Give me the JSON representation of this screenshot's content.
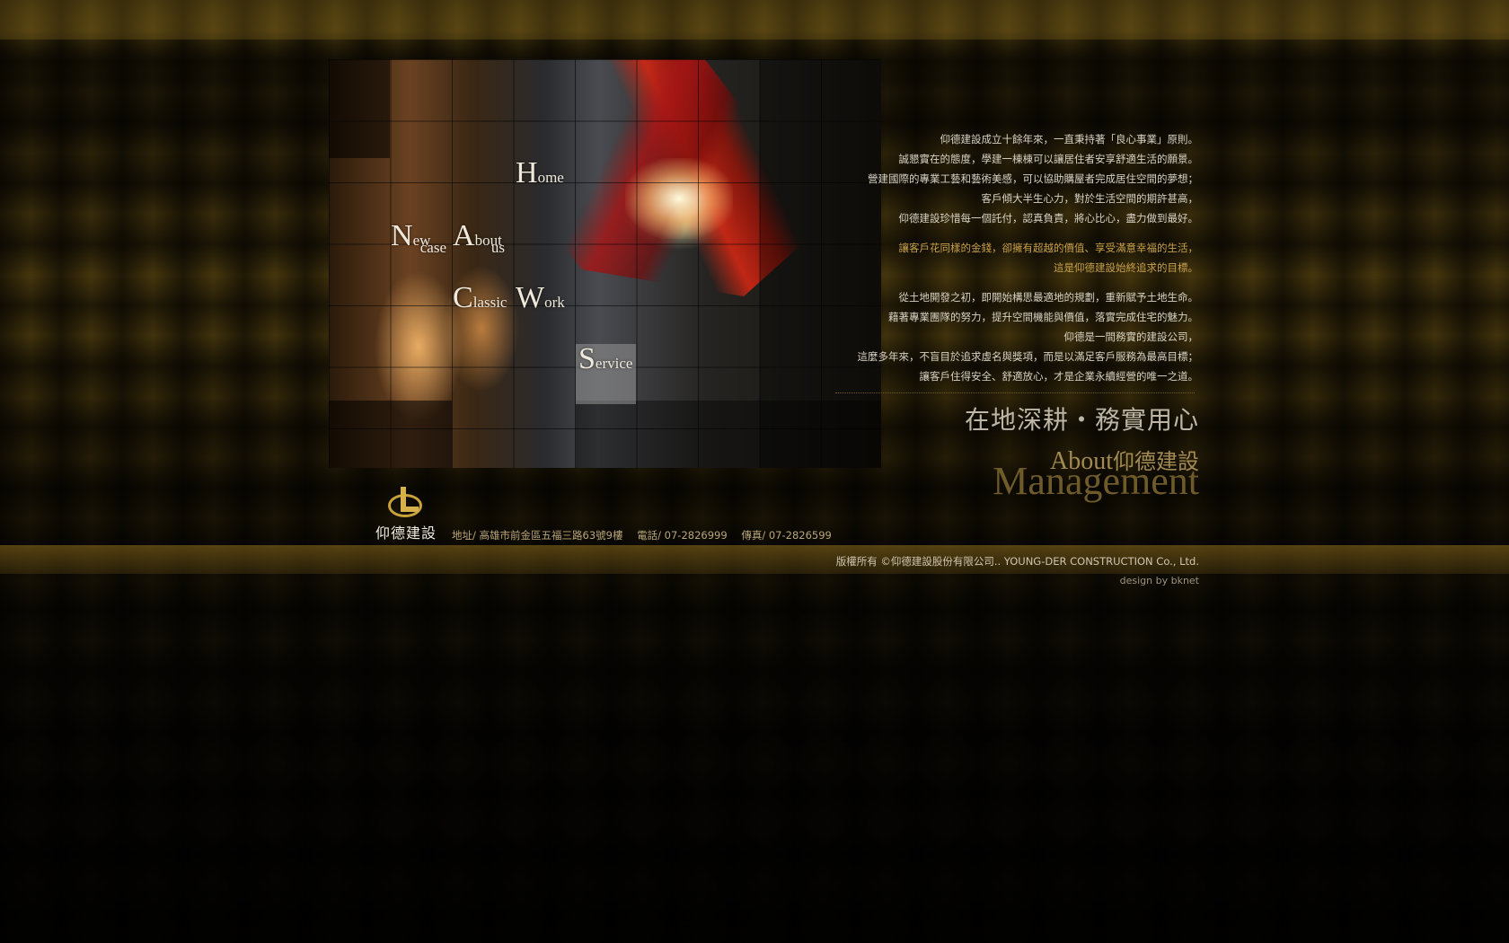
{
  "menu": {
    "home": {
      "big": "H",
      "small": "ome"
    },
    "new_case": {
      "big": "N",
      "small1": "ew",
      "small2": "case"
    },
    "about_us": {
      "big": "A",
      "small1": "bout",
      "small2": "us"
    },
    "classic": {
      "big": "C",
      "small": "lassic"
    },
    "work": {
      "big": "W",
      "small": "ork"
    },
    "service": {
      "big": "S",
      "small": "ervice"
    }
  },
  "about": {
    "para1": [
      "仰德建設成立十餘年來，一直秉持著「良心事業」原則。",
      "誠懇實在的態度，學建一棟棟可以讓居住者安享舒適生活的願景。",
      "營建國際的專業工藝和藝術美感，可以協助購屋者完成居住空間的夢想；",
      "客戶傾大半生心力，對於生活空間的期許甚高，",
      "仰德建設珍惜每一個託付，認真負責，將心比心，盡力做到最好。"
    ],
    "para2": [
      "讓客戶花同樣的金錢，卻擁有超越的價值、享受滿意幸福的生活，",
      "這是仰德建設始終追求的目標。"
    ],
    "para3": [
      "從土地開發之初，即開始構思最適地的規劃，重新賦予土地生命。",
      "藉著專業團隊的努力，提升空間機能與價值，落實完成住宅的魅力。",
      "仰德是一間務實的建設公司，",
      "這麼多年來，不盲目於追求虛名與獎項，而是以滿足客戶服務為最高目標；",
      "讓客戶住得安全、舒適放心，才是企業永續經營的唯一之道。"
    ]
  },
  "slogan": "在地深耕・務實用心",
  "section_title": {
    "en": "About",
    "cn": "仰德建設"
  },
  "management": "Management",
  "logo": {
    "name": "仰德建設",
    "icon": "company-logo-icon",
    "accent": "#c9a33a"
  },
  "footer": {
    "address": "地址/ 高雄市前金區五福三路63號9樓",
    "phone": "電話/ 07-2826999",
    "fax": "傳真/ 07-2826599",
    "copyright": "版權所有 ©仰德建設股份有限公司.. YOUNG-DER CONSTRUCTION Co., Ltd.",
    "credit": "design by  bknet"
  }
}
